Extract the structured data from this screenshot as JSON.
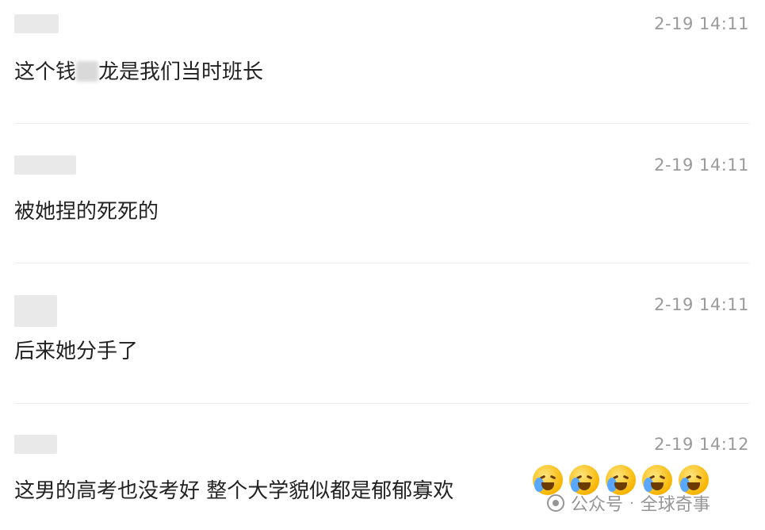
{
  "comments": [
    {
      "time": "2-19 14:11",
      "text_before": "这个钱",
      "text_after": "龙是我们当时班长"
    },
    {
      "time": "2-19 14:11",
      "text": "被她捏的死死的"
    },
    {
      "time": "2-19 14:11",
      "text": "后来她分手了"
    },
    {
      "time": "2-19 14:12",
      "text": "这男的高考也没考好 整个大学貌似都是郁郁寡欢"
    }
  ],
  "emojis": [
    "crying-laughing-emoji",
    "crying-laughing-emoji",
    "crying-laughing-emoji",
    "crying-laughing-emoji",
    "crying-laughing-emoji"
  ],
  "watermark": {
    "left": "公众号",
    "separator": "·",
    "right": "全球奇事"
  }
}
